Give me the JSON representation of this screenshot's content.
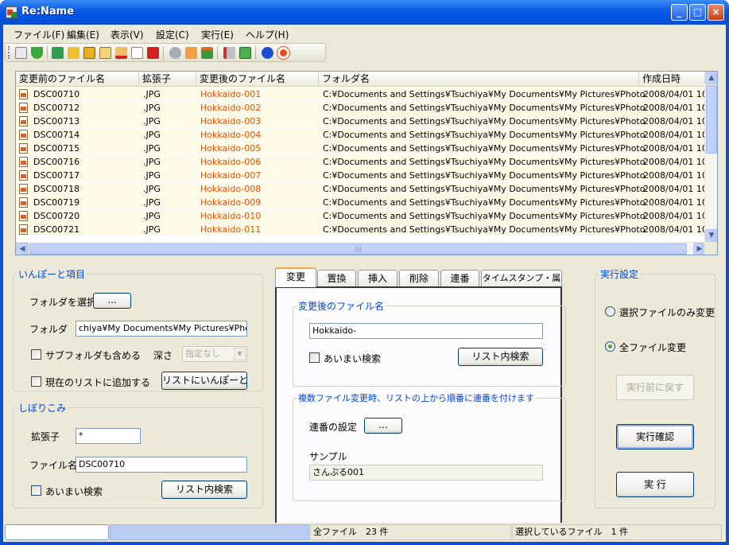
{
  "window": {
    "title": "Re:Name"
  },
  "title_buttons": {
    "minimize": "_",
    "maximize": "□",
    "close": "×"
  },
  "menu": [
    "ファイル(F)",
    "編集(E)",
    "表示(V)",
    "設定(C)",
    "実行(E)",
    "ヘルプ(H)"
  ],
  "toolbar": {
    "icons": [
      "copy-icon",
      "down-arrow-icon",
      "undo-icon",
      "folder-grid-icon",
      "folder-refresh-icon",
      "list-view-icon",
      "delete-row-icon",
      "paste-icon",
      "delete-icon",
      "settings-gear-icon",
      "pointer-icon",
      "swap-icon",
      "tools-icon",
      "export-icon",
      "info-icon",
      "help-lifebuoy-icon"
    ]
  },
  "file_list": {
    "columns": [
      "変更前のファイル名",
      "拡張子",
      "変更後のファイル名",
      "フォルダ名",
      "作成日時"
    ],
    "rows": [
      {
        "name": "DSC00710",
        "ext": ".JPG",
        "new_name": "Hokkaido-001",
        "folder": "C:¥Documents and Settings¥Tsuchiya¥My Documents¥My Pictures¥Photo",
        "created": "2008/04/01 10"
      },
      {
        "name": "DSC00712",
        "ext": ".JPG",
        "new_name": "Hokkaido-002",
        "folder": "C:¥Documents and Settings¥Tsuchiya¥My Documents¥My Pictures¥Photo",
        "created": "2008/04/01 10"
      },
      {
        "name": "DSC00713",
        "ext": ".JPG",
        "new_name": "Hokkaido-003",
        "folder": "C:¥Documents and Settings¥Tsuchiya¥My Documents¥My Pictures¥Photo",
        "created": "2008/04/01 10"
      },
      {
        "name": "DSC00714",
        "ext": ".JPG",
        "new_name": "Hokkaido-004",
        "folder": "C:¥Documents and Settings¥Tsuchiya¥My Documents¥My Pictures¥Photo",
        "created": "2008/04/01 10"
      },
      {
        "name": "DSC00715",
        "ext": ".JPG",
        "new_name": "Hokkaido-005",
        "folder": "C:¥Documents and Settings¥Tsuchiya¥My Documents¥My Pictures¥Photo",
        "created": "2008/04/01 10"
      },
      {
        "name": "DSC00716",
        "ext": ".JPG",
        "new_name": "Hokkaido-006",
        "folder": "C:¥Documents and Settings¥Tsuchiya¥My Documents¥My Pictures¥Photo",
        "created": "2008/04/01 10"
      },
      {
        "name": "DSC00717",
        "ext": ".JPG",
        "new_name": "Hokkaido-007",
        "folder": "C:¥Documents and Settings¥Tsuchiya¥My Documents¥My Pictures¥Photo",
        "created": "2008/04/01 10"
      },
      {
        "name": "DSC00718",
        "ext": ".JPG",
        "new_name": "Hokkaido-008",
        "folder": "C:¥Documents and Settings¥Tsuchiya¥My Documents¥My Pictures¥Photo",
        "created": "2008/04/01 10"
      },
      {
        "name": "DSC00719",
        "ext": ".JPG",
        "new_name": "Hokkaido-009",
        "folder": "C:¥Documents and Settings¥Tsuchiya¥My Documents¥My Pictures¥Photo",
        "created": "2008/04/01 10"
      },
      {
        "name": "DSC00720",
        "ext": ".JPG",
        "new_name": "Hokkaido-010",
        "folder": "C:¥Documents and Settings¥Tsuchiya¥My Documents¥My Pictures¥Photo",
        "created": "2008/04/01 10"
      },
      {
        "name": "DSC00721",
        "ext": ".JPG",
        "new_name": "Hokkaido-011",
        "folder": "C:¥Documents and Settings¥Tsuchiya¥My Documents¥My Pictures¥Photo",
        "created": "2008/04/01 10"
      }
    ]
  },
  "import": {
    "legend": "いんぽーと項目",
    "select_folder_label": "フォルダを選択",
    "browse_button": "...",
    "folder_label": "フォルダ",
    "folder_value": "chiya¥My Documents¥My Pictures¥Photo",
    "include_subfolders": "サブフォルダも含める",
    "depth_label": "深さ",
    "depth_value": "指定なし",
    "add_to_list": "現在のリストに追加する",
    "import_button": "リストにいんぽーと"
  },
  "filter": {
    "legend": "しぼりこみ",
    "ext_label": "拡張子",
    "ext_value": "*",
    "filename_label": "ファイル名",
    "filename_value": "DSC00710",
    "fuzzy": "あいまい検索",
    "search_button": "リスト内検索"
  },
  "tabs": [
    "変更",
    "置換",
    "挿入",
    "削除",
    "連番",
    "タイムスタンプ・属性"
  ],
  "change_tab": {
    "new_name_legend": "変更後のファイル名",
    "new_name_value": "Hokkaido-",
    "fuzzy": "あいまい検索",
    "search_button": "リスト内検索",
    "serial_legend": "複数ファイル変更時、リストの上から順番に連番を付けます",
    "serial_setting_label": "連番の設定",
    "serial_button": "...",
    "sample_label": "サンプル",
    "sample_value": "さんぷる001"
  },
  "exec": {
    "legend": "実行設定",
    "option_selected": "選択ファイルのみ変更",
    "option_all": "全ファイル変更",
    "undo_button": "実行前に戻す",
    "confirm_button": "実行確認",
    "run_button": "実 行"
  },
  "status": {
    "total": "全ファイル　23 件",
    "selected": "選択しているファイル　1 件"
  }
}
